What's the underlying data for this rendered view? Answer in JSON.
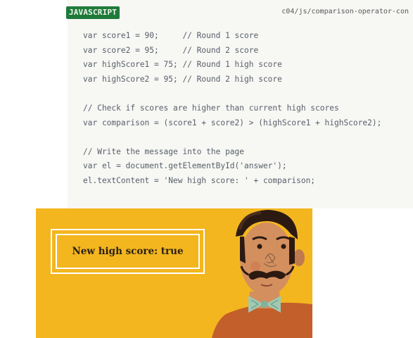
{
  "code_block": {
    "tag": "JAVASCRIPT",
    "file_path": "c04/js/comparison-operator-con",
    "lines": [
      "var score1 = 90;     // Round 1 score",
      "var score2 = 95;     // Round 2 score",
      "var highScore1 = 75; // Round 1 high score",
      "var highScore2 = 95; // Round 2 high score",
      "",
      "// Check if scores are higher than current high scores",
      "var comparison = (score1 + score2) > (highScore1 + highScore2);",
      "",
      "// Write the message into the page",
      "var el = document.getElementById('answer');",
      "el.textContent = 'New high score: ' + comparison;"
    ]
  },
  "result": {
    "message": "New high score: true",
    "illustration": "mustached-man-with-bow-tie-illustration"
  },
  "colors": {
    "tag_background": "#1f7a3a",
    "illustration_background": "#f3b61f",
    "code_text": "#58606a"
  }
}
